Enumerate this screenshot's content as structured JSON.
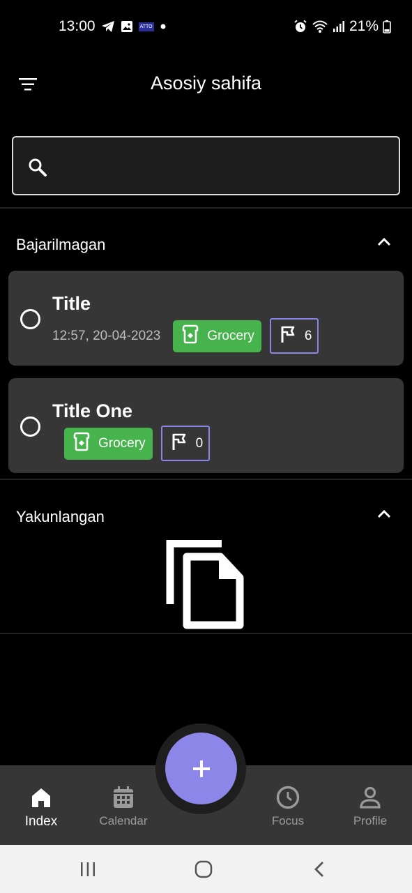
{
  "status_bar": {
    "time": "13:00",
    "atto_label": "ATTO",
    "battery": "21%"
  },
  "header": {
    "title": "Asosiy sahifa"
  },
  "search": {
    "placeholder": "",
    "value": ""
  },
  "sections": [
    {
      "label": "Bajarilmagan"
    },
    {
      "label": "Yakunlangan"
    }
  ],
  "tasks": [
    {
      "title": "Title",
      "time": "12:57,  20-04-2023",
      "category": "Grocery",
      "priority": "6"
    },
    {
      "title": "Title One",
      "time": "",
      "category": "Grocery",
      "priority": "0"
    }
  ],
  "bottom_nav": [
    {
      "label": "Index",
      "icon": "home-icon",
      "active": true
    },
    {
      "label": "Calendar",
      "icon": "calendar-icon",
      "active": false
    },
    {
      "label": "Focus",
      "icon": "clock-icon",
      "active": false
    },
    {
      "label": "Profile",
      "icon": "user-icon",
      "active": false
    }
  ],
  "fab": {
    "icon": "plus-icon"
  },
  "colors": {
    "accent": "#8b86e8",
    "category_green": "#47b34d",
    "card_bg": "#363636",
    "background": "#000000"
  }
}
